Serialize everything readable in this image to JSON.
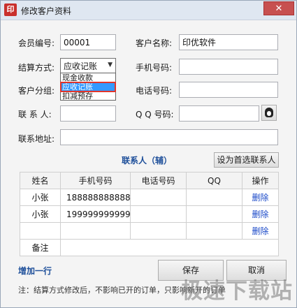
{
  "window": {
    "icon_text": "印",
    "title": "修改客户资料",
    "close_glyph": "✕"
  },
  "form": {
    "member_no": {
      "label": "会员编号:",
      "value": "00001"
    },
    "customer_name": {
      "label": "客户名称:",
      "value": "印优软件"
    },
    "settlement": {
      "label": "结算方式:",
      "value": "应收记账",
      "options": [
        "现金收款",
        "应收记账",
        "扣减预存"
      ],
      "selected_index": 1
    },
    "mobile": {
      "label": "手机号码:",
      "value": ""
    },
    "group": {
      "label": "客户分组:",
      "value": ""
    },
    "phone": {
      "label": "电话号码:",
      "value": ""
    },
    "contact": {
      "label": "联 系 人:",
      "value": ""
    },
    "qq": {
      "label": "Q Q 号码:",
      "value": ""
    },
    "address": {
      "label": "联系地址:",
      "value": ""
    }
  },
  "contacts": {
    "title": "联系人（辅）",
    "set_primary_label": "设为首选联系人",
    "columns": [
      "姓名",
      "手机号码",
      "电话号码",
      "QQ",
      "操作"
    ],
    "rows": [
      {
        "name": "小张",
        "mobile": "188888888888",
        "phone": "",
        "qq": "",
        "action": "删除"
      },
      {
        "name": "小张",
        "mobile": "199999999999",
        "phone": "",
        "qq": "",
        "action": "删除"
      },
      {
        "name": "",
        "mobile": "",
        "phone": "",
        "qq": "",
        "action": "删除"
      }
    ],
    "remark_label": "备注",
    "add_row_label": "增加一行"
  },
  "buttons": {
    "save": "保存",
    "cancel": "取消"
  },
  "note": "注：结算方式修改后，不影响已开的订单，只影响新开的订单",
  "watermark": "极速下载站"
}
